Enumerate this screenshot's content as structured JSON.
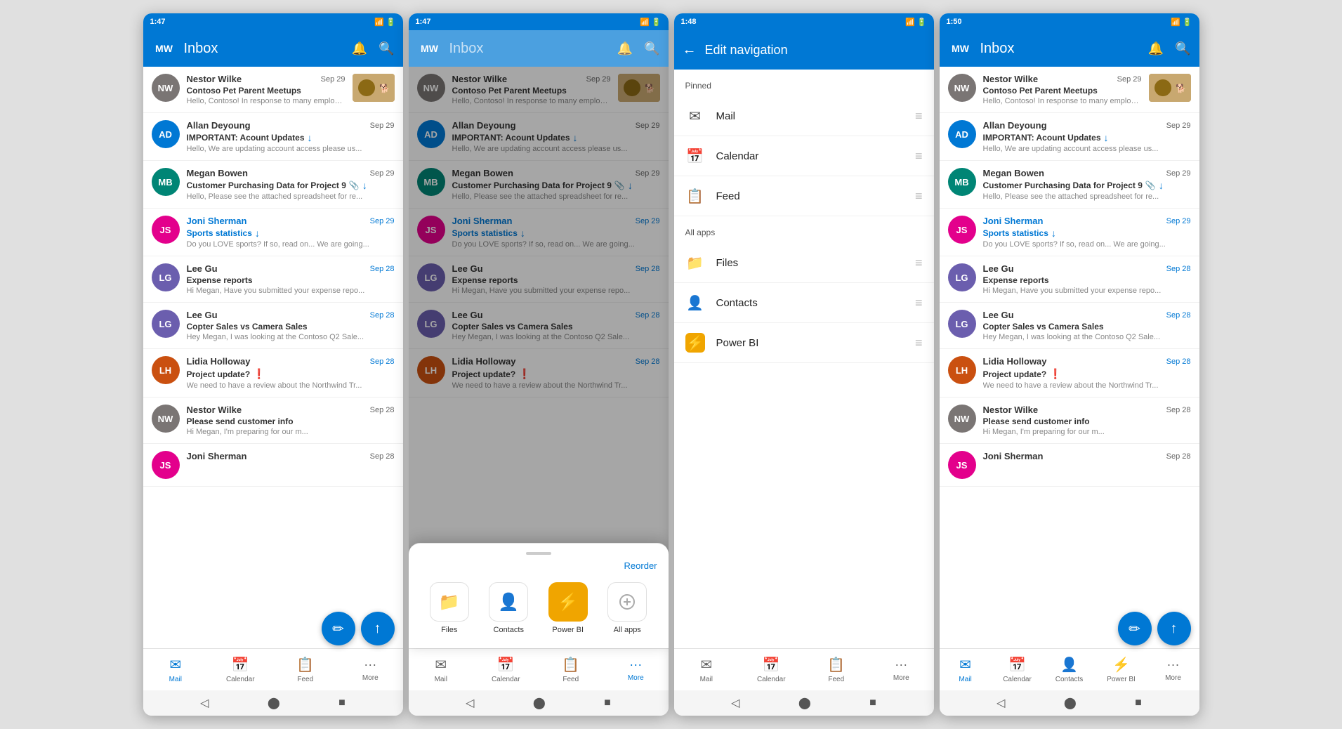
{
  "screens": [
    {
      "id": "screen1",
      "time": "1:47",
      "header": {
        "title": "Inbox",
        "title_dimmed": false
      },
      "emails": [
        {
          "sender": "Nestor Wilke",
          "subject": "Contoso Pet Parent Meetups",
          "preview": "Hello, Contoso! In response to many employee re...",
          "date": "Sep 29",
          "date_blue": false,
          "sender_bold": false,
          "has_thumbnail": true,
          "has_attachment": false,
          "has_download": false,
          "has_flag": false,
          "av_color": "av-gray"
        },
        {
          "sender": "Allan Deyoung",
          "subject": "IMPORTANT: Acount Updates",
          "preview": "Hello, We are updating account access please us...",
          "date": "Sep 29",
          "date_blue": false,
          "sender_bold": false,
          "has_thumbnail": false,
          "has_attachment": false,
          "has_download": true,
          "has_flag": false,
          "av_color": "av-blue"
        },
        {
          "sender": "Megan Bowen",
          "subject": "Customer Purchasing Data for Project 9",
          "preview": "Hello, Please see the attached spreadsheet for re...",
          "date": "Sep 29",
          "date_blue": false,
          "sender_bold": false,
          "has_thumbnail": false,
          "has_attachment": true,
          "has_download": true,
          "has_flag": false,
          "av_color": "av-teal"
        },
        {
          "sender": "Joni Sherman",
          "subject": "Sports statistics",
          "preview": "Do you LOVE sports? If so, read on... We are going...",
          "date": "Sep 29",
          "date_blue": true,
          "sender_bold": true,
          "has_thumbnail": false,
          "has_attachment": false,
          "has_download": true,
          "has_flag": false,
          "av_color": "av-pink"
        },
        {
          "sender": "Lee Gu",
          "subject": "Expense reports",
          "preview": "Hi Megan, Have you submitted your expense repo...",
          "date": "Sep 28",
          "date_blue": true,
          "sender_bold": false,
          "has_thumbnail": false,
          "has_attachment": false,
          "has_download": false,
          "has_flag": false,
          "av_color": "av-purple"
        },
        {
          "sender": "Lee Gu",
          "subject": "Copter Sales vs Camera Sales",
          "preview": "Hey Megan, I was looking at the Contoso Q2 Sale...",
          "date": "Sep 28",
          "date_blue": true,
          "sender_bold": false,
          "has_thumbnail": false,
          "has_attachment": false,
          "has_download": false,
          "has_flag": false,
          "av_color": "av-purple"
        },
        {
          "sender": "Lidia Holloway",
          "subject": "Project update?",
          "preview": "We need to have a review about the Northwind Tr...",
          "date": "Sep 28",
          "date_blue": true,
          "sender_bold": false,
          "has_thumbnail": false,
          "has_attachment": false,
          "has_download": false,
          "has_flag": true,
          "av_color": "av-orange"
        },
        {
          "sender": "Nestor Wilke",
          "subject": "Please send customer info",
          "preview": "Hi Megan, I'm preparing for our m...",
          "date": "Sep 28",
          "date_blue": false,
          "sender_bold": false,
          "has_thumbnail": false,
          "has_attachment": false,
          "has_download": false,
          "has_flag": false,
          "av_color": "av-gray"
        },
        {
          "sender": "Joni Sherman",
          "subject": "",
          "preview": "",
          "date": "Sep 28",
          "date_blue": false,
          "sender_bold": false,
          "has_thumbnail": false,
          "has_attachment": false,
          "has_download": false,
          "has_flag": false,
          "av_color": "av-pink"
        }
      ],
      "nav": {
        "items": [
          {
            "label": "Mail",
            "active": true
          },
          {
            "label": "Calendar",
            "active": false
          },
          {
            "label": "Feed",
            "active": false
          },
          {
            "label": "More",
            "active": false
          }
        ]
      },
      "show_panel": false,
      "show_edit_nav": false
    },
    {
      "id": "screen2",
      "time": "1:47",
      "header": {
        "title": "Inbox",
        "title_dimmed": true
      },
      "emails": [
        {
          "sender": "Nestor Wilke",
          "subject": "Contoso Pet Parent Meetups",
          "preview": "Hello, Contoso! In response to many employee re...",
          "date": "Sep 29",
          "date_blue": false,
          "sender_bold": false,
          "has_thumbnail": true,
          "has_attachment": false,
          "has_download": false,
          "has_flag": false,
          "av_color": "av-gray"
        },
        {
          "sender": "Allan Deyoung",
          "subject": "IMPORTANT: Acount Updates",
          "preview": "Hello, We are updating account access please us...",
          "date": "Sep 29",
          "date_blue": false,
          "sender_bold": false,
          "has_thumbnail": false,
          "has_attachment": false,
          "has_download": true,
          "has_flag": false,
          "av_color": "av-blue"
        },
        {
          "sender": "Megan Bowen",
          "subject": "Customer Purchasing Data for Project 9",
          "preview": "Hello, Please see the attached spreadsheet for re...",
          "date": "Sep 29",
          "date_blue": false,
          "sender_bold": false,
          "has_thumbnail": false,
          "has_attachment": true,
          "has_download": true,
          "has_flag": false,
          "av_color": "av-teal"
        },
        {
          "sender": "Joni Sherman",
          "subject": "Sports statistics",
          "preview": "Do you LOVE sports? If so, read on... We are going...",
          "date": "Sep 29",
          "date_blue": true,
          "sender_bold": true,
          "has_thumbnail": false,
          "has_attachment": false,
          "has_download": true,
          "has_flag": false,
          "av_color": "av-pink"
        },
        {
          "sender": "Lee Gu",
          "subject": "Expense reports",
          "preview": "Hi Megan, Have you submitted your expense repo...",
          "date": "Sep 28",
          "date_blue": true,
          "sender_bold": false,
          "has_thumbnail": false,
          "has_attachment": false,
          "has_download": false,
          "has_flag": false,
          "av_color": "av-purple"
        },
        {
          "sender": "Lee Gu",
          "subject": "Copter Sales vs Camera Sales",
          "preview": "Hey Megan, I was looking at the Contoso Q2 Sale...",
          "date": "Sep 28",
          "date_blue": true,
          "sender_bold": false,
          "has_thumbnail": false,
          "has_attachment": false,
          "has_download": false,
          "has_flag": false,
          "av_color": "av-purple"
        },
        {
          "sender": "Lidia Holloway",
          "subject": "Project update?",
          "preview": "We need to have a review about the Northwind Tr...",
          "date": "Sep 28",
          "date_blue": true,
          "sender_bold": false,
          "has_thumbnail": false,
          "has_attachment": false,
          "has_download": false,
          "has_flag": true,
          "av_color": "av-orange"
        }
      ],
      "nav": {
        "items": [
          {
            "label": "Mail",
            "active": false
          },
          {
            "label": "Calendar",
            "active": false
          },
          {
            "label": "Feed",
            "active": false
          },
          {
            "label": "More",
            "active": true
          }
        ]
      },
      "show_panel": true,
      "panel": {
        "reorder_label": "Reorder",
        "items": [
          {
            "label": "Files",
            "icon": "📁",
            "yellow": false
          },
          {
            "label": "Contacts",
            "icon": "👤",
            "yellow": false
          },
          {
            "label": "Power BI",
            "icon": "⚡",
            "yellow": true
          },
          {
            "label": "All apps",
            "icon": "+",
            "yellow": false
          }
        ]
      },
      "show_edit_nav": false
    },
    {
      "id": "screen3",
      "time": "1:48",
      "edit_nav": {
        "title": "Edit navigation",
        "sections": [
          {
            "label": "Pinned",
            "items": [
              {
                "label": "Mail",
                "icon": "✉"
              },
              {
                "label": "Calendar",
                "icon": "📅"
              },
              {
                "label": "Feed",
                "icon": "📋"
              }
            ]
          },
          {
            "label": "All apps",
            "items": [
              {
                "label": "Files",
                "icon": "📁"
              },
              {
                "label": "Contacts",
                "icon": "👤"
              },
              {
                "label": "Power BI",
                "icon": "⚡",
                "yellow": true
              }
            ]
          }
        ]
      },
      "nav": {
        "items": [
          {
            "label": "Mail",
            "active": false
          },
          {
            "label": "Calendar",
            "active": false
          },
          {
            "label": "Feed",
            "active": false
          },
          {
            "label": "More",
            "active": false
          }
        ]
      }
    },
    {
      "id": "screen4",
      "time": "1:50",
      "header": {
        "title": "Inbox",
        "title_dimmed": false
      },
      "emails": [
        {
          "sender": "Nestor Wilke",
          "subject": "Contoso Pet Parent Meetups",
          "preview": "Hello, Contoso! In response to many employee re...",
          "date": "Sep 29",
          "date_blue": false,
          "sender_bold": false,
          "has_thumbnail": true,
          "has_attachment": false,
          "has_download": false,
          "has_flag": false,
          "av_color": "av-gray"
        },
        {
          "sender": "Allan Deyoung",
          "subject": "IMPORTANT: Acount Updates",
          "preview": "Hello, We are updating account access please us...",
          "date": "Sep 29",
          "date_blue": false,
          "sender_bold": false,
          "has_thumbnail": false,
          "has_attachment": false,
          "has_download": true,
          "has_flag": false,
          "av_color": "av-blue"
        },
        {
          "sender": "Megan Bowen",
          "subject": "Customer Purchasing Data for Project 9",
          "preview": "Hello, Please see the attached spreadsheet for re...",
          "date": "Sep 29",
          "date_blue": false,
          "sender_bold": false,
          "has_thumbnail": false,
          "has_attachment": true,
          "has_download": true,
          "has_flag": false,
          "av_color": "av-teal"
        },
        {
          "sender": "Joni Sherman",
          "subject": "Sports statistics",
          "preview": "Do you LOVE sports? If so, read on... We are going...",
          "date": "Sep 29",
          "date_blue": true,
          "sender_bold": true,
          "has_thumbnail": false,
          "has_attachment": false,
          "has_download": true,
          "has_flag": false,
          "av_color": "av-pink"
        },
        {
          "sender": "Lee Gu",
          "subject": "Expense reports",
          "preview": "Hi Megan, Have you submitted your expense repo...",
          "date": "Sep 28",
          "date_blue": true,
          "sender_bold": false,
          "has_thumbnail": false,
          "has_attachment": false,
          "has_download": false,
          "has_flag": false,
          "av_color": "av-purple"
        },
        {
          "sender": "Lee Gu",
          "subject": "Copter Sales vs Camera Sales",
          "preview": "Hey Megan, I was looking at the Contoso Q2 Sale...",
          "date": "Sep 28",
          "date_blue": true,
          "sender_bold": false,
          "has_thumbnail": false,
          "has_attachment": false,
          "has_download": false,
          "has_flag": false,
          "av_color": "av-purple"
        },
        {
          "sender": "Lidia Holloway",
          "subject": "Project update?",
          "preview": "We need to have a review about the Northwind Tr...",
          "date": "Sep 28",
          "date_blue": true,
          "sender_bold": false,
          "has_thumbnail": false,
          "has_attachment": false,
          "has_download": false,
          "has_flag": true,
          "av_color": "av-orange"
        },
        {
          "sender": "Nestor Wilke",
          "subject": "Please send customer info",
          "preview": "Hi Megan, I'm preparing for our m...",
          "date": "Sep 28",
          "date_blue": false,
          "sender_bold": false,
          "has_thumbnail": false,
          "has_attachment": false,
          "has_download": false,
          "has_flag": false,
          "av_color": "av-gray"
        },
        {
          "sender": "Joni Sherman",
          "subject": "",
          "preview": "",
          "date": "Sep 28",
          "date_blue": false,
          "sender_bold": false,
          "has_thumbnail": false,
          "has_attachment": false,
          "has_download": false,
          "has_flag": false,
          "av_color": "av-pink"
        }
      ],
      "nav": {
        "items": [
          {
            "label": "Mail",
            "active": true
          },
          {
            "label": "Calendar",
            "active": false
          },
          {
            "label": "Contacts",
            "active": false
          },
          {
            "label": "Power BI",
            "active": false
          },
          {
            "label": "More",
            "active": false
          }
        ]
      },
      "show_panel": false,
      "show_edit_nav": false
    }
  ],
  "icons": {
    "mail": "✉",
    "calendar": "📅",
    "feed": "📋",
    "more": "···",
    "bell": "🔔",
    "search": "🔍",
    "back": "←",
    "compose": "✏",
    "up": "↑",
    "contacts": "👤",
    "powerbi": "⚡",
    "files": "📁"
  }
}
